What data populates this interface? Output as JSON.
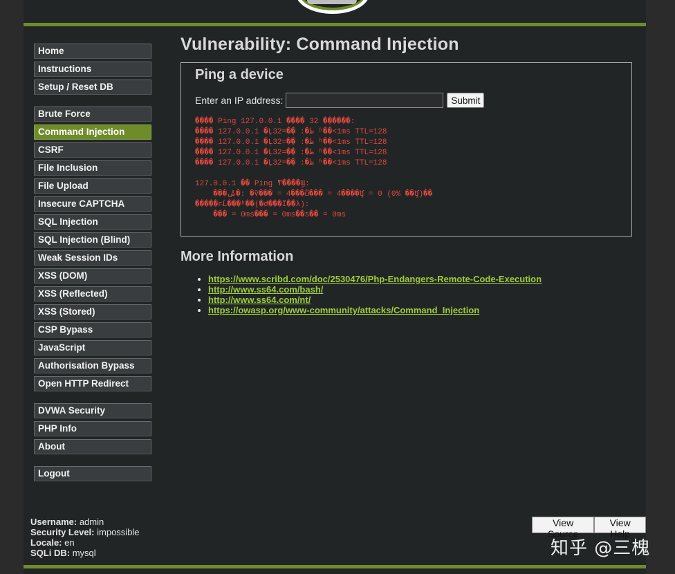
{
  "menu": {
    "group1": [
      "Home",
      "Instructions",
      "Setup / Reset DB"
    ],
    "group2": [
      "Brute Force",
      "Command Injection",
      "CSRF",
      "File Inclusion",
      "File Upload",
      "Insecure CAPTCHA",
      "SQL Injection",
      "SQL Injection (Blind)",
      "Weak Session IDs",
      "XSS (DOM)",
      "XSS (Reflected)",
      "XSS (Stored)",
      "CSP Bypass",
      "JavaScript",
      "Authorisation Bypass",
      "Open HTTP Redirect"
    ],
    "group3": [
      "DVWA Security",
      "PHP Info",
      "About"
    ],
    "group4": [
      "Logout"
    ],
    "selected": "Command Injection"
  },
  "main": {
    "title": "Vulnerability: Command Injection",
    "box_title": "Ping a device",
    "ip_label": "Enter an IP address:",
    "ip_value": "",
    "submit_label": "Submit",
    "ping_output": "���� Ping 127.0.0.1 ���� 32 �ֽ�����:\n���� 127.0.0.1 �Ļظ�: �ֽ�=32 ʱ��<1ms TTL=128\n���� 127.0.0.1 �Ļظ�: �ֽ�=32 ʱ��<1ms TTL=128\n���� 127.0.0.1 �Ļظ�: �ֽ�=32 ʱ��<1ms TTL=128\n���� 127.0.0.1 �Ļظ�: �ֽ�=32 ʱ��<1ms TTL=128\n\n127.0.0.1 �� Ping ͳ����Ϣ:\n    ���ݰ�: �ѷ��� = 4���ѽ��� = 4����ʧ = 0 (0% ��ʧ)��\n�����г̵Ĺ���ʱ��(�Ժ���Ϊ��λ):\n    ��� = 0ms��� = 0ms��ƽ�� = 0ms",
    "more_info_title": "More Information",
    "links": [
      "https://www.scribd.com/doc/2530476/Php-Endangers-Remote-Code-Execution",
      "http://www.ss64.com/bash/",
      "http://www.ss64.com/nt/",
      "https://owasp.org/www-community/attacks/Command_Injection"
    ]
  },
  "footer": {
    "username_label": "Username:",
    "username": "admin",
    "security_label": "Security Level:",
    "security": "impossible",
    "locale_label": "Locale:",
    "locale": "en",
    "sqli_label": "SQLi DB:",
    "sqli": "mysql",
    "view_source_label": "View Source",
    "view_help_label": "View Help"
  },
  "watermark": "知乎 @三槐",
  "colors": {
    "accent": "#6f8c2b",
    "link": "#9ccf3c",
    "output": "#e0483d",
    "background": "#222526"
  }
}
